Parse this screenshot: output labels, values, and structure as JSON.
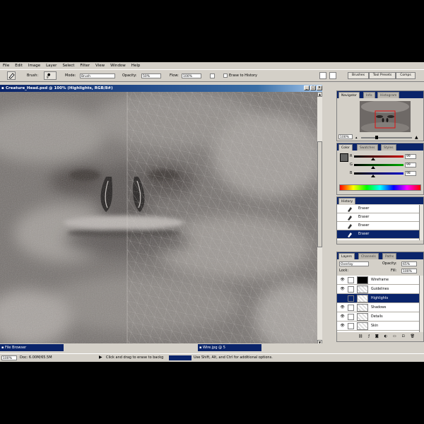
{
  "menu": [
    "File",
    "Edit",
    "Image",
    "Layer",
    "Select",
    "Filter",
    "View",
    "Window",
    "Help"
  ],
  "options": {
    "brush_label": "Brush:",
    "brush_size": "9",
    "mode_label": "Mode:",
    "mode_value": "Brush",
    "opacity_label": "Opacity:",
    "opacity_value": "50%",
    "flow_label": "Flow:",
    "flow_value": "100%",
    "erase_label": "Erase to History"
  },
  "palette_well": {
    "tabs": [
      "Brushes",
      "Tool Presets",
      "Comps"
    ]
  },
  "document": {
    "title": "Creature_Head.psd @ 100% (Highlights, RGB/8#)"
  },
  "navigator": {
    "tabs": [
      "Navigator",
      "Info",
      "Histogram"
    ],
    "zoom": "100%"
  },
  "color_panel": {
    "tabs": [
      "Color",
      "Swatches",
      "Styles"
    ],
    "channels": [
      {
        "label": "R",
        "value": "99",
        "pos": 0.39
      },
      {
        "label": "G",
        "value": "99",
        "pos": 0.39
      },
      {
        "label": "B",
        "value": "98",
        "pos": 0.38
      }
    ]
  },
  "history": {
    "tabs": [
      "History"
    ],
    "items": [
      "Eraser",
      "Eraser",
      "Eraser",
      "Eraser"
    ],
    "selected_index": 3
  },
  "layers": {
    "tabs": [
      "Layers",
      "Channels",
      "Paths"
    ],
    "blend_mode": "Overlay",
    "opacity_label": "Opacity:",
    "opacity_value": "65%",
    "lock_label": "Lock:",
    "fill_label": "Fill:",
    "fill_value": "100%",
    "items": [
      {
        "name": "Wireframe",
        "visible": true
      },
      {
        "name": "Guidelines",
        "visible": true
      },
      {
        "name": "Highlights",
        "visible": false,
        "selected": true
      },
      {
        "name": "Shadows",
        "visible": true
      },
      {
        "name": "Details",
        "visible": true
      },
      {
        "name": "Skin",
        "visible": true
      }
    ]
  },
  "taskbar": {
    "items": [
      "File Browser",
      "Wire.jpg @ 5"
    ]
  },
  "status": {
    "zoom": "100%",
    "doc": "Doc: 6.00M/65.5M",
    "hint_start": "Click and drag to erase to backg",
    "hint_end": "Use Shift, Alt, and Ctrl for additional options."
  },
  "colors": {
    "title_blue": "#0a246a",
    "panel_gray": "#d4d0c8",
    "selection": "#0a246a"
  }
}
